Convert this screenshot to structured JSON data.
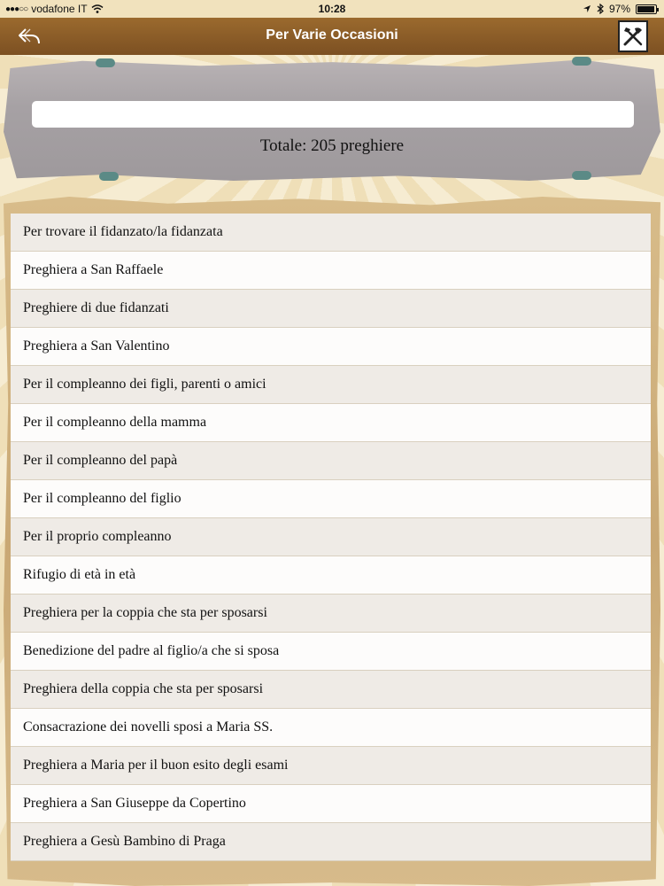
{
  "status_bar": {
    "carrier": "vodafone IT",
    "time": "10:28",
    "battery": "97%"
  },
  "nav": {
    "title": "Per Varie Occasioni",
    "back_icon": "back-arrow-icon",
    "tools_icon": "tools-icon"
  },
  "search": {
    "value": "",
    "placeholder": ""
  },
  "total_label": "Totale: 205 preghiere",
  "prayers": [
    "Per trovare il fidanzato/la fidanzata",
    "Preghiera a San Raffaele",
    "Preghiere di due fidanzati",
    "Preghiera a San Valentino",
    "Per il compleanno dei figli, parenti o amici",
    "Per il compleanno della mamma",
    "Per il compleanno del papà",
    "Per il compleanno del figlio",
    "Per il proprio compleanno",
    "Rifugio di età in età",
    "Preghiera per la coppia che sta per sposarsi",
    "Benedizione del padre al figlio/a che si sposa",
    "Preghiera della coppia che sta per sposarsi",
    "Consacrazione dei novelli sposi a Maria SS.",
    "Preghiera a Maria per il buon esito degli esami",
    "Preghiera a San Giuseppe da Copertino",
    "Preghiera a Gesù Bambino di Praga"
  ],
  "colors": {
    "nav_bar": "#8a5c27",
    "row_odd": "#efebe6",
    "row_even": "#fdfcfb"
  }
}
